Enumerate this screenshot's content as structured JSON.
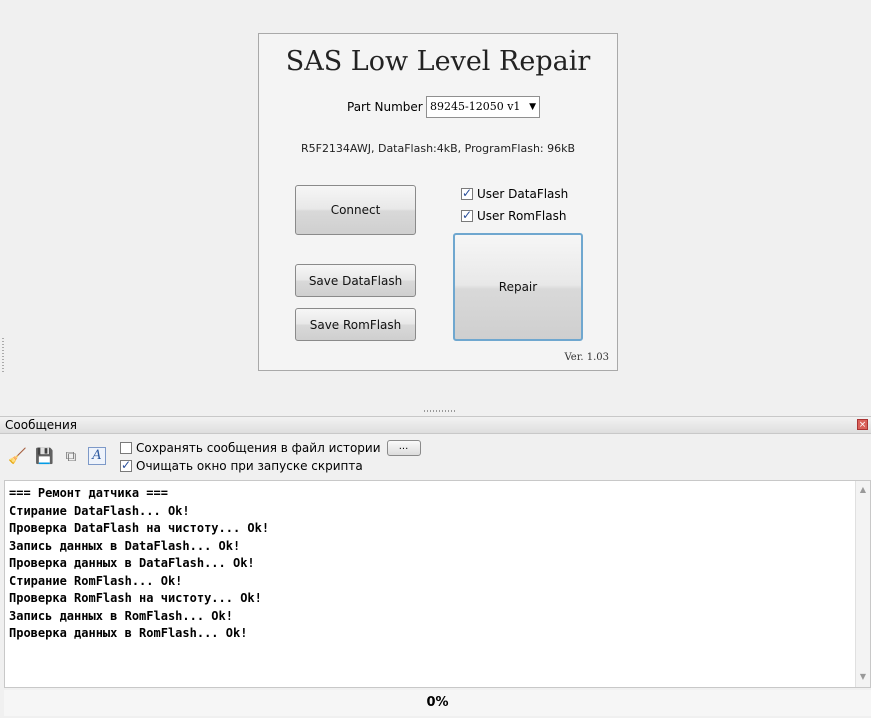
{
  "app": {
    "title": "SAS Low Level Repair",
    "part_number_label": "Part Number",
    "part_number_value": "89245-12050 v1",
    "chip_info": "R5F2134AWJ, DataFlash:4kB, ProgramFlash: 96kB",
    "connect_label": "Connect",
    "save_dataflash_label": "Save DataFlash",
    "save_romflash_label": "Save RomFlash",
    "repair_label": "Repair",
    "user_dataflash": {
      "label": "User DataFlash",
      "checked": true
    },
    "user_romflash": {
      "label": "User RomFlash",
      "checked": true
    },
    "version": "Ver. 1.03"
  },
  "messages": {
    "title": "Сообщения",
    "close_glyph": "×",
    "save_to_history": {
      "label": "Сохранять сообщения в файл истории",
      "checked": false
    },
    "browse_label": "...",
    "clear_on_start": {
      "label": "Очищать окно при запуске скрипта",
      "checked": true
    },
    "toolbar_icons": [
      "broom-icon",
      "save-icon",
      "copy-icon",
      "font-icon"
    ],
    "log_lines": [
      "=== Ремонт датчика ===",
      "Стирание DataFlash... Ok!",
      "Проверка DataFlash на чистоту... Ok!",
      "Запись данных в DataFlash... Ok!",
      "Проверка данных в DataFlash... Ok!",
      "Стирание RomFlash... Ok!",
      "Проверка RomFlash на чистоту... Ok!",
      "Запись данных в RomFlash... Ok!",
      "Проверка данных в RomFlash... Ok!"
    ]
  },
  "progress": {
    "value_percent": 0,
    "label": "0%"
  }
}
